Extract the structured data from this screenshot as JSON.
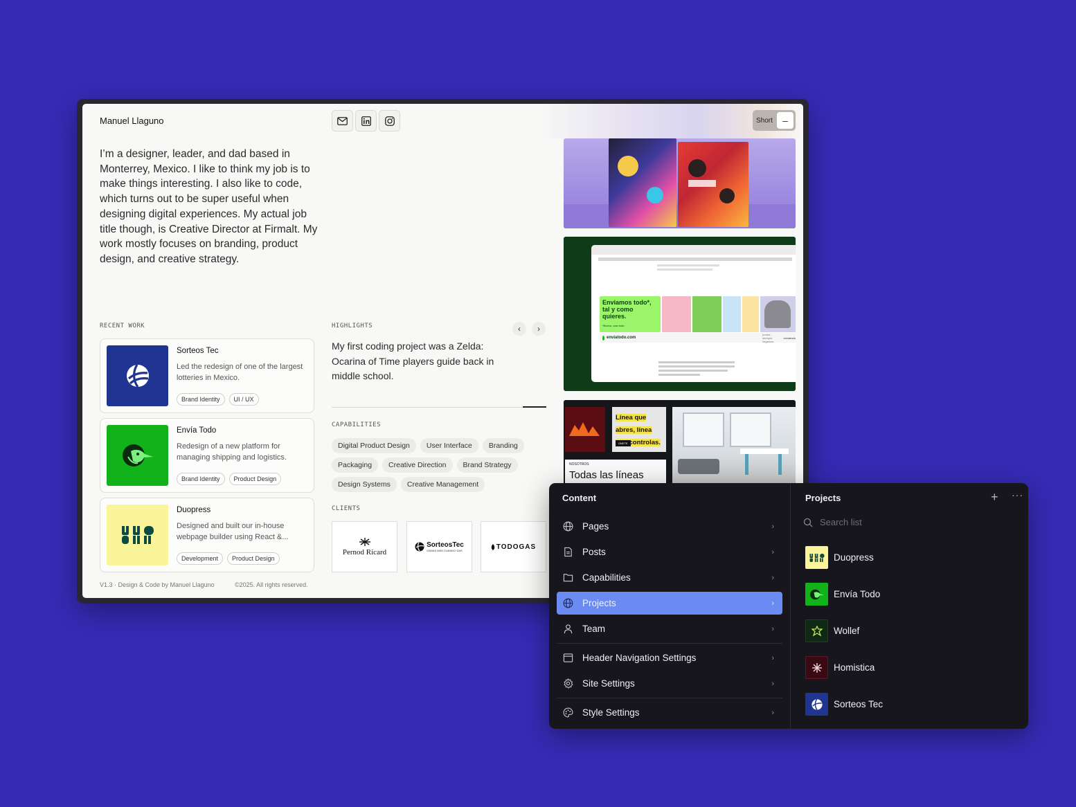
{
  "site": {
    "name": "Manuel Llaguno",
    "toggle_label": "Short",
    "toggle_symbol": "–",
    "bio": "I’m a designer, leader, and dad based in Monterrey, Mexico. I like to think my job is to make things interesting. I also like to code, which turns out to be super useful when designing digital experiences. My actual job title though, is Creative Director at Firmalt. My work mostly focuses on branding, product design, and creative strategy.",
    "recent_work_label": "RECENT WORK",
    "highlights_label": "HIGHLIGHTS",
    "capabilities_label": "CAPABILITIES",
    "clients_label": "CLIENTS",
    "highlight_text": "My first coding project was a Zelda: Ocarina of Time players guide back in middle school.",
    "prev_arrow": "‹",
    "next_arrow": "›",
    "footer_left": "V1.3 · Design & Code by Manuel Llaguno",
    "footer_right": "©2025. All rights reserved."
  },
  "recent_work": [
    {
      "title": "Sorteos Tec",
      "desc": "Led the redesign of one of the largest lotteries in Mexico.",
      "tags": [
        "Brand Identity",
        "UI / UX"
      ],
      "color": "#1f3591"
    },
    {
      "title": "Envía Todo",
      "desc": "Redesign of a new platform for managing shipping and logistics.",
      "tags": [
        "Brand Identity",
        "Product Design"
      ],
      "color": "#12b31a"
    },
    {
      "title": "Duopress",
      "desc": "Designed and built our in-house webpage builder using React &...",
      "tags": [
        "Development",
        "Product Design"
      ],
      "color": "#fbf59a"
    }
  ],
  "capabilities": [
    "Digital Product Design",
    "User Interface",
    "Branding",
    "Packaging",
    "Creative Direction",
    "Brand Strategy",
    "Design Systems",
    "Creative Management"
  ],
  "clients": [
    {
      "name": "Pernod Ricard",
      "sub": ""
    },
    {
      "name": "SorteosTec",
      "sub": "GANAS MÁS CUANDO DAS"
    },
    {
      "name": "TODOGAS",
      "sub": ""
    }
  ],
  "images": {
    "envia_headline": "Enviamos todo*, tal y como quieres.",
    "envia_small": "*Bueno, casi todo.",
    "envia_url": "enviatodo.com",
    "envia_footer": "juntos, siempre llegamos",
    "envia_brand": "enviatodo",
    "linea_text": "Línea que abres, línea que controlas.",
    "linea_button": "ÚNETE",
    "nosotros_label": "NOSOTROS",
    "todas_text": "Todas las líneas"
  },
  "cms": {
    "content_title": "Content",
    "nav": [
      {
        "label": "Pages",
        "icon": "globe-icon"
      },
      {
        "label": "Posts",
        "icon": "document-icon"
      },
      {
        "label": "Capabilities",
        "icon": "folder-icon"
      },
      {
        "label": "Projects",
        "icon": "globe-icon",
        "active": true
      },
      {
        "label": "Team",
        "icon": "user-icon"
      },
      {
        "label": "Header Navigation Settings",
        "icon": "layout-icon"
      },
      {
        "label": "Site Settings",
        "icon": "gear-icon"
      },
      {
        "label": "Style Settings",
        "icon": "palette-icon"
      }
    ],
    "chevron": "›",
    "projects_title": "Projects",
    "add_symbol": "+",
    "more_symbol": "···",
    "search_placeholder": "Search list",
    "projects": [
      {
        "name": "Duopress",
        "color": "#fbf59a"
      },
      {
        "name": "Envía Todo",
        "color": "#12b31a"
      },
      {
        "name": "Wollef",
        "color": "#0f2a14"
      },
      {
        "name": "Homistica",
        "color": "#3a0a14"
      },
      {
        "name": "Sorteos Tec",
        "color": "#1f3591"
      }
    ]
  },
  "colors": {
    "background": "#352bb5",
    "active_nav": "#6a8cf2",
    "panel": "#16161c"
  }
}
